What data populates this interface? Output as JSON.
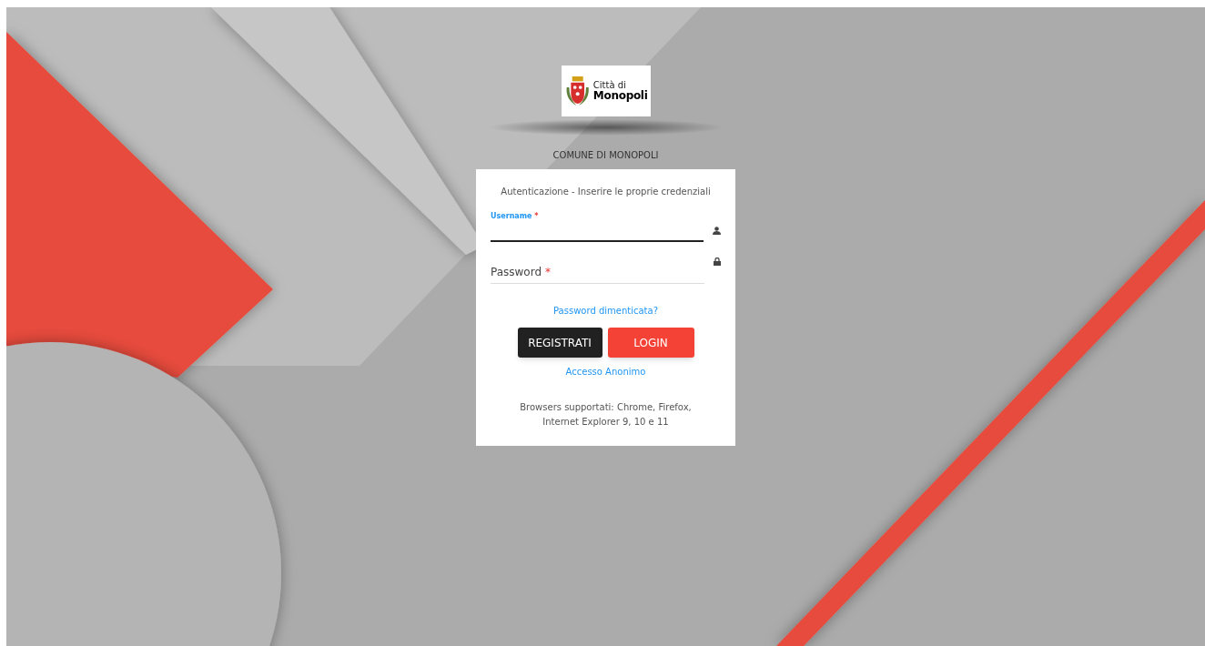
{
  "logo": {
    "line_1": "Città di",
    "line_2": "Monopoli"
  },
  "organization": "COMUNE DI MONOPOLI",
  "login_card": {
    "title": "Autenticazione - Inserire le proprie credenziali",
    "fields": [
      {
        "kind": "text",
        "label": "Username",
        "required_mark": "*",
        "focused": true
      },
      {
        "kind": "password",
        "label": "Password",
        "required_mark": "*",
        "focused": false
      }
    ],
    "forgot_link": "Password dimenticata?",
    "buttons": [
      {
        "kind": "secondary",
        "label": "REGISTRATI"
      },
      {
        "kind": "primary",
        "label": "LOGIN"
      }
    ],
    "anonymous_link": "Accesso Anonimo",
    "browser_note": "Browsers supportati: Chrome, Firefox, Internet Explorer 9, 10 e 11"
  }
}
